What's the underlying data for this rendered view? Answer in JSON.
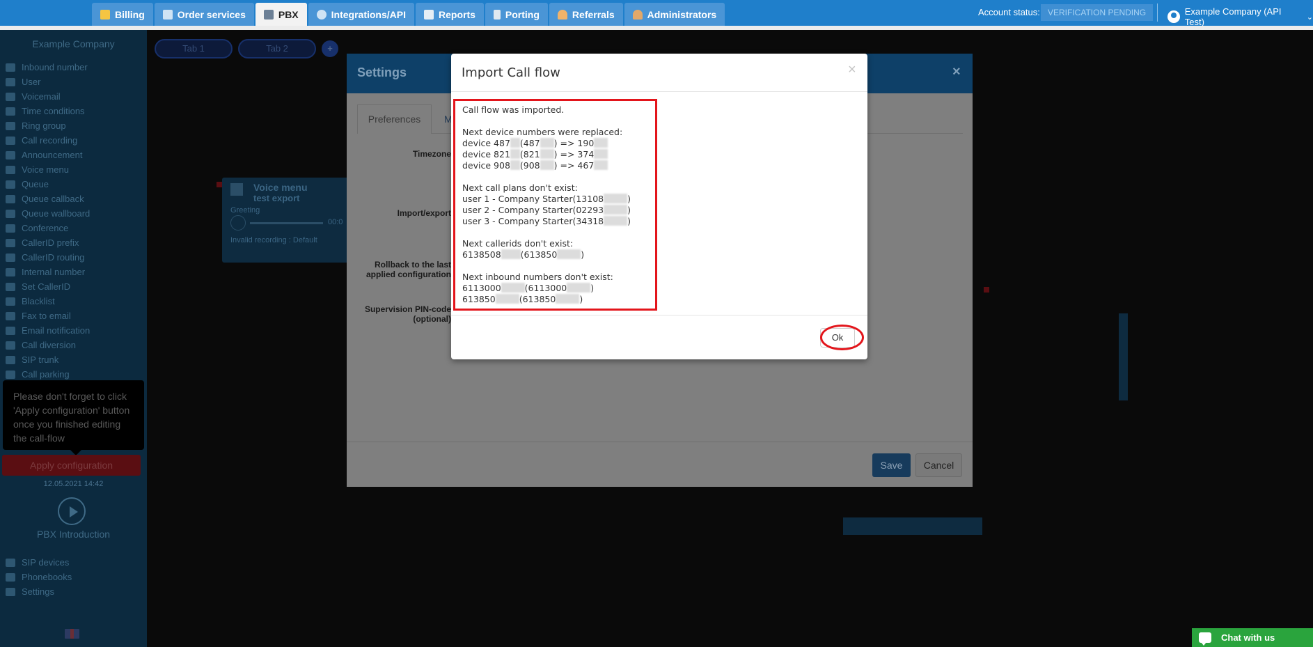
{
  "nav": {
    "tabs": [
      {
        "label": "Billing",
        "icon": "coins-icon",
        "active": false
      },
      {
        "label": "Order services",
        "icon": "cart-icon",
        "active": false
      },
      {
        "label": "PBX",
        "icon": "pbx-icon",
        "active": true
      },
      {
        "label": "Integrations/API",
        "icon": "sync-icon",
        "active": false
      },
      {
        "label": "Reports",
        "icon": "report-icon",
        "active": false
      },
      {
        "label": "Porting",
        "icon": "phone-icon",
        "active": false
      },
      {
        "label": "Referrals",
        "icon": "person-icon",
        "active": false
      },
      {
        "label": "Administrators",
        "icon": "admin-icon",
        "active": false
      }
    ],
    "account_status_label": "Account status:",
    "account_status_value": "VERIFICATION PENDING",
    "user_name": "Example Company (API Test)"
  },
  "sidebar": {
    "company": "Example Company",
    "items": [
      "Inbound number",
      "User",
      "Voicemail",
      "Time conditions",
      "Ring group",
      "Call recording",
      "Announcement",
      "Voice menu",
      "Queue",
      "Queue callback",
      "Queue wallboard",
      "Conference",
      "CallerID prefix",
      "CallerID routing",
      "Internal number",
      "Set CallerID",
      "Blacklist",
      "Fax to email",
      "Email notification",
      "Call diversion",
      "SIP trunk",
      "Call parking"
    ],
    "tooltip": "Please don't forget to click 'Apply configuration' button once you finished editing the call-flow",
    "apply_label": "Apply configuration",
    "applied_time": "12.05.2021 14:42",
    "intro_label": "PBX Introduction",
    "bottom_items": [
      "SIP devices",
      "Phonebooks",
      "Settings"
    ]
  },
  "canvas": {
    "tabs": [
      "Tab 1",
      "Tab 2"
    ],
    "add_tab": "+",
    "voice_menu": {
      "title": "Voice menu",
      "subtitle": "test export",
      "greeting_label": "Greeting",
      "time": "00:0",
      "invalid_recording": "Invalid recording",
      "invalid_value": ": Default"
    }
  },
  "settings": {
    "title": "Settings",
    "close": "×",
    "tab_preferences": "Preferences",
    "tab_more": "M",
    "labels": {
      "timezone": "Timezone",
      "import_export": "Import/export",
      "rollback": "Rollback to the last applied configuration",
      "supervision": "Supervision PIN-code (optional)"
    },
    "save_label": "Save",
    "cancel_label": "Cancel"
  },
  "import_dialog": {
    "title": "Import Call flow",
    "close": "×",
    "imported_msg": "Call flow was imported.",
    "devices_heading": "Next device numbers were replaced:",
    "devices": [
      {
        "prefix": "device 487",
        "mid": "(487",
        "arrow": ") => 190"
      },
      {
        "prefix": "device 821",
        "mid": "(821",
        "arrow": ") => 374"
      },
      {
        "prefix": "device 908",
        "mid": "(908",
        "arrow": ") => 467"
      }
    ],
    "plans_heading": "Next call plans don't exist:",
    "plans": [
      {
        "text": "user 1 - Company Starter(13108",
        "end": ")"
      },
      {
        "text": "user 2 - Company Starter(02293",
        "end": ")"
      },
      {
        "text": "user 3 - Company Starter(34318",
        "end": ")"
      }
    ],
    "callerids_heading": "Next callerids don't exist:",
    "callerids": [
      {
        "a": "6138508",
        "b": "(613850",
        "end": ")"
      }
    ],
    "inbound_heading": "Next inbound numbers don't exist:",
    "inbound": [
      {
        "a": "6113000",
        "b": "(6113000",
        "end": ")"
      },
      {
        "a": "613850",
        "b": "(613850",
        "end": ")"
      }
    ],
    "ok_label": "Ok"
  },
  "chat": {
    "label": "Chat with us"
  },
  "colors": {
    "nav_blue": "#1f7fcb",
    "highlight_red": "#e3151b",
    "chat_green": "#2aa43d"
  }
}
